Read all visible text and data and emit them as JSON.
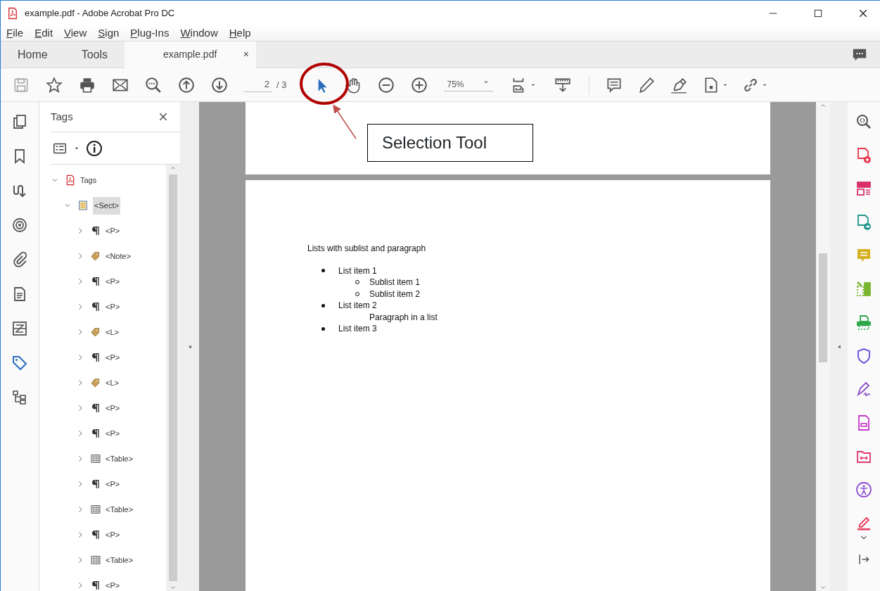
{
  "window": {
    "title": "example.pdf - Adobe Acrobat Pro DC"
  },
  "menu": [
    "File",
    "Edit",
    "View",
    "Sign",
    "Plug-Ins",
    "Window",
    "Help"
  ],
  "tabs": [
    {
      "label": "Home",
      "selected": false
    },
    {
      "label": "Tools",
      "selected": false
    },
    {
      "label": "example.pdf",
      "selected": true,
      "close": "×"
    }
  ],
  "toolbar": {
    "page": "2",
    "page_total": "/ 3",
    "zoom": "75%",
    "tools": [
      {
        "kind": "select",
        "selected": true
      },
      {
        "kind": "hand",
        "selected": false
      }
    ]
  },
  "left_rail": [
    {
      "kind": "pages",
      "selected": false
    },
    {
      "kind": "bookmark",
      "selected": false
    },
    {
      "kind": "order",
      "selected": false
    },
    {
      "kind": "target",
      "selected": false
    },
    {
      "kind": "clip",
      "selected": false
    },
    {
      "kind": "content",
      "selected": false
    },
    {
      "kind": "fields",
      "selected": false
    },
    {
      "kind": "tag",
      "selected": true
    },
    {
      "kind": "tree",
      "selected": false
    }
  ],
  "tags_panel": {
    "title": "Tags",
    "tree": [
      {
        "label": "Tags",
        "kind": "pdf",
        "expanded": true,
        "children": [
          {
            "label": "<Sect>",
            "kind": "sect",
            "expanded": true,
            "selected": true,
            "children": [
              {
                "label": "<P>",
                "kind": "para",
                "expanded": false
              },
              {
                "label": "<Note>",
                "kind": "tag",
                "expanded": false
              },
              {
                "label": "<P>",
                "kind": "para",
                "expanded": false
              },
              {
                "label": "<P>",
                "kind": "para",
                "expanded": false
              },
              {
                "label": "<L>",
                "kind": "tag",
                "expanded": false
              },
              {
                "label": "<P>",
                "kind": "para",
                "expanded": false
              },
              {
                "label": "<L>",
                "kind": "tag",
                "expanded": false
              },
              {
                "label": "<P>",
                "kind": "para",
                "expanded": false
              },
              {
                "label": "<P>",
                "kind": "para",
                "expanded": false
              },
              {
                "label": "<Table>",
                "kind": "table",
                "expanded": false
              },
              {
                "label": "<P>",
                "kind": "para",
                "expanded": false
              },
              {
                "label": "<Table>",
                "kind": "table",
                "expanded": false
              },
              {
                "label": "<P>",
                "kind": "para",
                "expanded": false
              },
              {
                "label": "<Table>",
                "kind": "table",
                "expanded": false
              },
              {
                "label": "<P>",
                "kind": "para",
                "expanded": false
              }
            ]
          }
        ]
      }
    ]
  },
  "document": {
    "heading": "Lists with sublist and paragraph",
    "items": [
      {
        "text": "List item 1",
        "children": [
          {
            "text": "Sublist item 1"
          },
          {
            "text": "Sublist item 2"
          }
        ]
      },
      {
        "text": "List item 2",
        "paragraph": "Paragraph in a list"
      },
      {
        "text": "List item 3"
      }
    ]
  },
  "callout": {
    "text": "Selection Tool"
  },
  "right_rail": [
    {
      "kind": "search",
      "color": "#555555"
    },
    {
      "kind": "create",
      "color": "#e8334a"
    },
    {
      "kind": "layout",
      "color": "#d9306b"
    },
    {
      "kind": "export",
      "color": "#1f968c"
    },
    {
      "kind": "comment",
      "color": "#d4b020"
    },
    {
      "kind": "organize",
      "color": "#79b531"
    },
    {
      "kind": "scan",
      "color": "#2ea84a"
    },
    {
      "kind": "protect",
      "color": "#6a5ce0"
    },
    {
      "kind": "sign",
      "color": "#8b4fc9"
    },
    {
      "kind": "form",
      "color": "#c637c9"
    },
    {
      "kind": "compare",
      "color": "#e0356e"
    },
    {
      "kind": "access",
      "color": "#8e4fd1"
    },
    {
      "kind": "redact",
      "color": "#e83a5a"
    }
  ]
}
